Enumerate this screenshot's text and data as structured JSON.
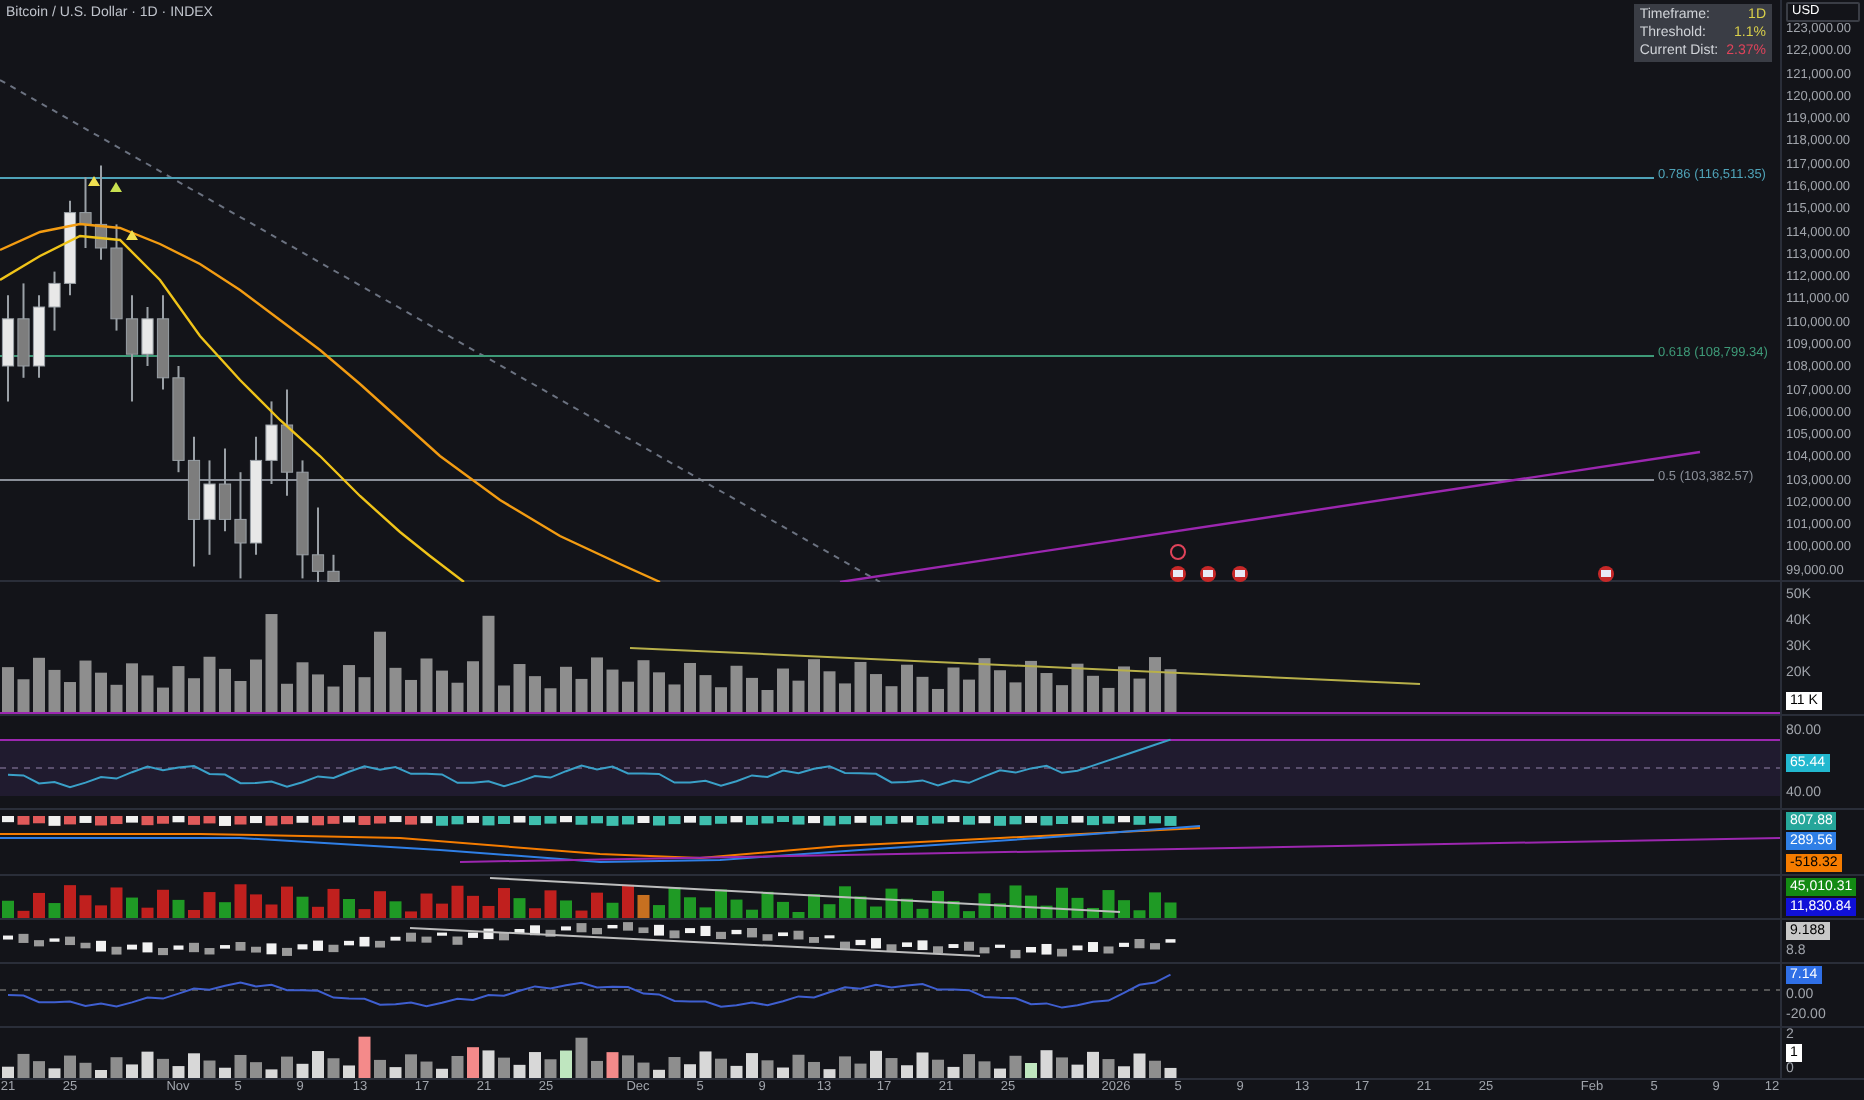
{
  "header": {
    "title": "Bitcoin / U.S. Dollar · 1D · INDEX"
  },
  "info_table": [
    {
      "label": "Timeframe:",
      "value": "1D",
      "color": "#d8cf4a"
    },
    {
      "label": "Threshold:",
      "value": "1.1%",
      "color": "#d8cf4a"
    },
    {
      "label": "Current Dist:",
      "value": "2.37%",
      "color": "#e0435a"
    }
  ],
  "price_axis": {
    "currency": "USD",
    "labels": [
      "123,000.00",
      "122,000.00",
      "121,000.00",
      "120,000.00",
      "119,000.00",
      "118,000.00",
      "117,000.00",
      "116,000.00",
      "115,000.00",
      "114,000.00",
      "113,000.00",
      "112,000.00",
      "111,000.00",
      "110,000.00",
      "109,000.00",
      "108,000.00",
      "107,000.00",
      "106,000.00",
      "105,000.00",
      "104,000.00",
      "103,000.00",
      "102,000.00",
      "101,000.00",
      "100,000.00",
      "99,000.00"
    ]
  },
  "fib_levels": [
    {
      "label": "0.786 (116,511.35)",
      "color": "#4fa3b8"
    },
    {
      "label": "0.618 (108,799.34)",
      "color": "#3e9a78"
    },
    {
      "label": "0.5 (103,382.57)",
      "color": "#8a8f98"
    }
  ],
  "panes": [
    {
      "kind": "volume",
      "axis": [
        {
          "kind": "label",
          "text": "50K"
        },
        {
          "kind": "label",
          "text": "40K"
        },
        {
          "kind": "label",
          "text": "30K"
        },
        {
          "kind": "label",
          "text": "20K"
        },
        {
          "kind": "badge",
          "text": "11 K",
          "color": "#ffffff"
        }
      ]
    },
    {
      "kind": "rsi",
      "axis": [
        {
          "kind": "label",
          "text": "80.00"
        },
        {
          "kind": "badge",
          "text": "65.44",
          "color": "#22b8cf"
        },
        {
          "kind": "label",
          "text": "40.00"
        }
      ]
    },
    {
      "kind": "macd",
      "axis": [
        {
          "kind": "badge",
          "text": "807.88",
          "color": "#26a69a"
        },
        {
          "kind": "badge",
          "text": "289.56",
          "color": "#2f7fe6"
        },
        {
          "kind": "badge",
          "text": "-518.32",
          "color": "#f57c00"
        }
      ]
    },
    {
      "kind": "histogram",
      "axis": [
        {
          "kind": "badge",
          "text": "45,010.31",
          "color": "#138a13"
        },
        {
          "kind": "badge",
          "text": "11,830.84",
          "color": "#1010d8"
        }
      ]
    },
    {
      "kind": "candles",
      "axis": [
        {
          "kind": "badge",
          "text": "9.188",
          "color": "#c8c8c8"
        },
        {
          "kind": "label",
          "text": "8.8"
        }
      ]
    },
    {
      "kind": "oscillator",
      "axis": [
        {
          "kind": "badge",
          "text": "7.14",
          "color": "#2f6fe6"
        },
        {
          "kind": "label",
          "text": "0.00"
        },
        {
          "kind": "label",
          "text": "-20.00"
        }
      ]
    },
    {
      "kind": "counts",
      "axis": [
        {
          "kind": "label",
          "text": "2"
        },
        {
          "kind": "badge",
          "text": "1",
          "color": "#ffffff"
        },
        {
          "kind": "label",
          "text": "0"
        }
      ]
    }
  ],
  "time_axis": [
    "21",
    "25",
    "Nov",
    "5",
    "9",
    "13",
    "17",
    "21",
    "25",
    "Dec",
    "5",
    "9",
    "13",
    "17",
    "21",
    "25",
    "2026",
    "5",
    "9",
    "13",
    "17",
    "21",
    "25",
    "Feb",
    "5",
    "9",
    "12"
  ]
}
